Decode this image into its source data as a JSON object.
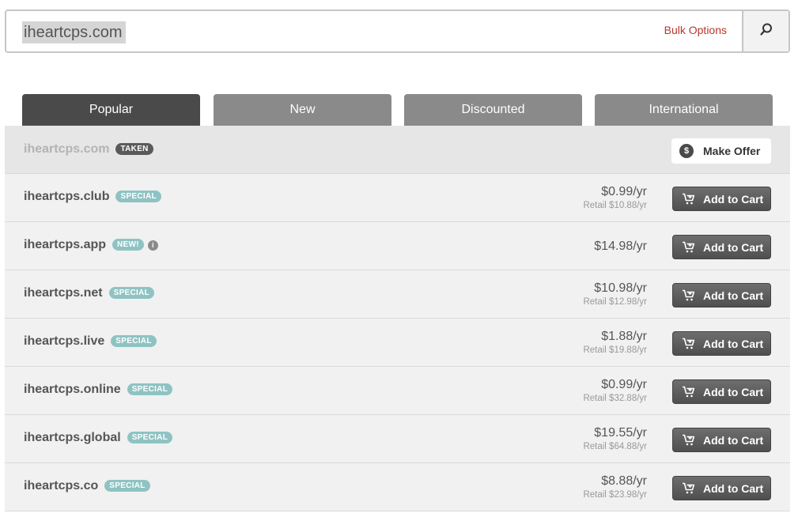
{
  "search": {
    "value": "iheartcps.com",
    "bulk_options": "Bulk Options",
    "button_icon": "search-icon"
  },
  "tabs": [
    {
      "label": "Popular",
      "active": true
    },
    {
      "label": "New",
      "active": false
    },
    {
      "label": "Discounted",
      "active": false
    },
    {
      "label": "International",
      "active": false
    }
  ],
  "rows": [
    {
      "domain": "iheartcps.com",
      "badge": "TAKEN",
      "action": "Make Offer"
    },
    {
      "domain": "iheartcps.club",
      "badge": "SPECIAL",
      "price": "$0.99/yr",
      "retail": "Retail $10.88/yr",
      "action": "Add to Cart"
    },
    {
      "domain": "iheartcps.app",
      "badge": "NEW!",
      "info": "i",
      "price": "$14.98/yr",
      "action": "Add to Cart"
    },
    {
      "domain": "iheartcps.net",
      "badge": "SPECIAL",
      "price": "$10.98/yr",
      "retail": "Retail $12.98/yr",
      "action": "Add to Cart"
    },
    {
      "domain": "iheartcps.live",
      "badge": "SPECIAL",
      "price": "$1.88/yr",
      "retail": "Retail $19.88/yr",
      "action": "Add to Cart"
    },
    {
      "domain": "iheartcps.online",
      "badge": "SPECIAL",
      "price": "$0.99/yr",
      "retail": "Retail $32.88/yr",
      "action": "Add to Cart"
    },
    {
      "domain": "iheartcps.global",
      "badge": "SPECIAL",
      "price": "$19.55/yr",
      "retail": "Retail $64.88/yr",
      "action": "Add to Cart"
    },
    {
      "domain": "iheartcps.co",
      "badge": "SPECIAL",
      "price": "$8.88/yr",
      "retail": "Retail $23.98/yr",
      "action": "Add to Cart"
    }
  ],
  "offer_icon": "$"
}
